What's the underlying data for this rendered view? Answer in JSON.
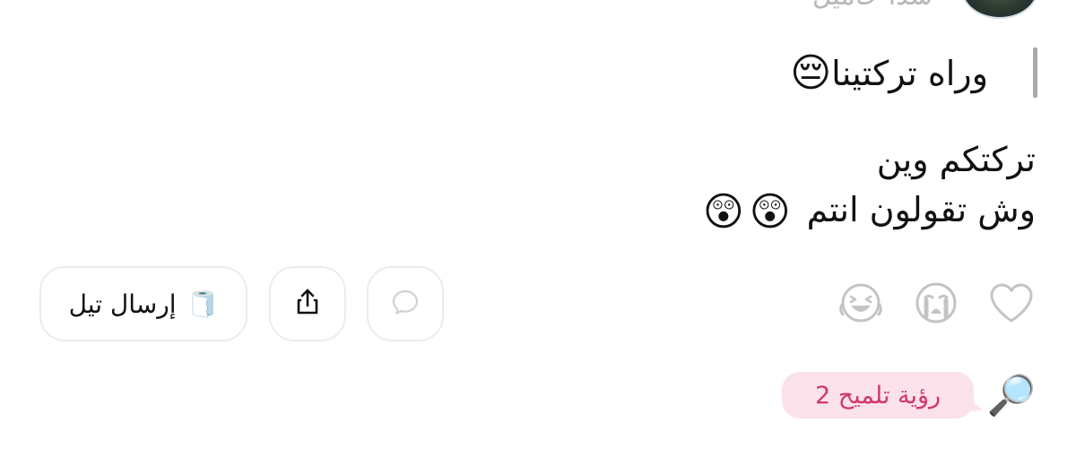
{
  "header": {
    "name_partial": "سدا حاميل"
  },
  "quote": {
    "text": "وراه تركتينا",
    "emoji": "😔"
  },
  "message": {
    "line1": "تركتكم وين",
    "line2": "وش تقولون انتم",
    "emoji1": "😲",
    "emoji2": "😲"
  },
  "actions": {
    "send_label": "إرسال تيل",
    "send_icon": "🧻",
    "icons": {
      "comment": "comment-bubble-icon",
      "share": "share-upload-icon",
      "heart": "heart-icon",
      "cry": "crying-face-icon",
      "laugh": "laughing-face-icon"
    }
  },
  "hint": {
    "label": "رؤية تلميح 2",
    "icon": "🔎"
  },
  "colors": {
    "hint_background": "#fbe2ea",
    "hint_text": "#d0386a",
    "icon_gray": "#c4c4c4",
    "quote_bar": "#a9a9a9"
  }
}
